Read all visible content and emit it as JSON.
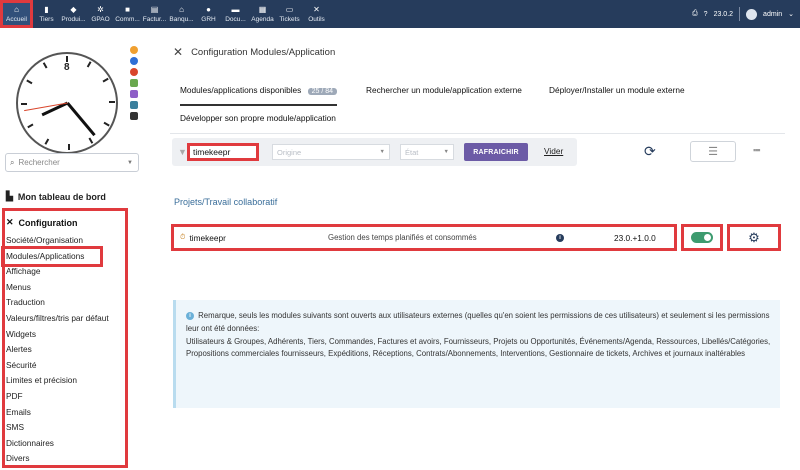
{
  "topnav": {
    "items": [
      {
        "label": "Accueil",
        "icon": "home-icon"
      },
      {
        "label": "Tiers",
        "icon": "building-icon"
      },
      {
        "label": "Produi...",
        "icon": "cube-icon"
      },
      {
        "label": "GPAO",
        "icon": "cogs-icon"
      },
      {
        "label": "Comm...",
        "icon": "briefcase-icon"
      },
      {
        "label": "Factur...",
        "icon": "invoice-icon"
      },
      {
        "label": "Banqu...",
        "icon": "bank-icon"
      },
      {
        "label": "GRH",
        "icon": "users-icon"
      },
      {
        "label": "Docu...",
        "icon": "folder-icon"
      },
      {
        "label": "Agenda",
        "icon": "calendar-icon"
      },
      {
        "label": "Tickets",
        "icon": "ticket-icon"
      },
      {
        "label": "Outils",
        "icon": "tools-icon"
      }
    ],
    "version": "23.0.2",
    "user": "admin"
  },
  "sidebar": {
    "clock_number": "8",
    "search_placeholder": "Rechercher",
    "dashboard_label": "Mon tableau de bord",
    "section_title": "Configuration",
    "items": [
      "Société/Organisation",
      "Modules/Applications",
      "Affichage",
      "Menus",
      "Traduction",
      "Valeurs/filtres/tris par défaut",
      "Widgets",
      "Alertes",
      "Sécurité",
      "Limites et précision",
      "PDF",
      "Emails",
      "SMS",
      "Dictionnaires",
      "Divers"
    ],
    "active_index": 1
  },
  "main": {
    "title": "Configuration Modules/Application",
    "tabs": [
      {
        "label": "Modules/applications disponibles",
        "badge": "25 / 84"
      },
      {
        "label": "Rechercher un module/application externe"
      },
      {
        "label": "Déployer/Installer un module externe"
      },
      {
        "label": "Développer son propre module/application"
      }
    ],
    "filter": {
      "name_value": "timekeepr",
      "origin_placeholder": "Origine",
      "state_placeholder": "État",
      "refresh_label": "RAFRAICHIR",
      "clear_label": "Vider"
    },
    "section": "Projets/Travail collaboratif",
    "module": {
      "name": "timekeepr",
      "description": "Gestion des temps planifiés et consommés",
      "version": "23.0.+1.0.0",
      "enabled": true
    },
    "notice": "Remarque, seuls les modules suivants sont ouverts aux utilisateurs externes (quelles qu'en soient les permissions de ces utilisateurs) et seulement si les permissions leur ont été données:",
    "notice_list": "Utilisateurs & Groupes, Adhérents, Tiers, Commandes, Factures et avoirs, Fournisseurs, Projets ou Opportunités, Événements/Agenda, Ressources, Libellés/Catégories, Propositions commerciales fournisseurs, Expéditions, Réceptions, Contrats/Abonnements, Interventions, Gestionnaire de tickets, Archives et journaux inaltérables"
  },
  "colors": {
    "topbar": "#263c5c",
    "accent_button": "#6c5ba6",
    "toggle_on": "#3d9b6f",
    "highlight": "#e03a3e"
  }
}
